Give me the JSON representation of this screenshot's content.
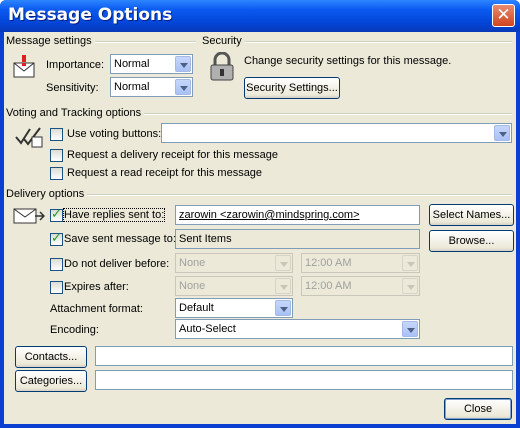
{
  "window": {
    "title": "Message Options",
    "close_glyph": "✕"
  },
  "message_settings": {
    "heading": "Message settings",
    "importance_label": "Importance:",
    "importance_value": "Normal",
    "sensitivity_label": "Sensitivity:",
    "sensitivity_value": "Normal"
  },
  "security": {
    "heading": "Security",
    "description": "Change security settings for this message.",
    "button_label": "Security Settings..."
  },
  "voting": {
    "heading": "Voting and Tracking options",
    "use_voting_label": "Use voting buttons:",
    "voting_value": "",
    "delivery_receipt_label": "Request a delivery receipt for this message",
    "read_receipt_label": "Request a read receipt for this message"
  },
  "delivery": {
    "heading": "Delivery options",
    "replies_label": "Have replies sent to:",
    "replies_value": "zarowin <zarowin@mindspring.com>",
    "select_names_label": "Select Names...",
    "save_sent_label": "Save sent message to:",
    "save_sent_value": "Sent Items",
    "browse_label": "Browse...",
    "do_not_deliver_label": "Do not deliver before:",
    "do_not_deliver_date": "None",
    "do_not_deliver_time": "12:00 AM",
    "expires_label": "Expires after:",
    "expires_date": "None",
    "expires_time": "12:00 AM",
    "attachment_format_label": "Attachment format:",
    "attachment_format_value": "Default",
    "encoding_label": "Encoding:",
    "encoding_value": "Auto-Select"
  },
  "bottom": {
    "contacts_label": "Contacts...",
    "contacts_value": "",
    "categories_label": "Categories...",
    "categories_value": "",
    "close_label": "Close"
  },
  "checkboxes": {
    "use_voting": false,
    "delivery_receipt": false,
    "read_receipt": false,
    "have_replies": true,
    "save_sent": true,
    "do_not_deliver": false,
    "expires": false
  }
}
